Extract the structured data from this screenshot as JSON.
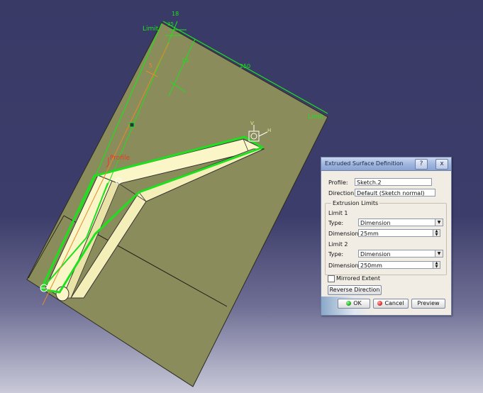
{
  "viewport": {
    "labels": {
      "limit_top": "Limit",
      "limit_right": "Limit",
      "profile": "Profile",
      "dim_18": "18",
      "dim_35": "35",
      "dim_250": "250",
      "dim_15": "15",
      "dim_5": "5",
      "axis_v": "V",
      "axis_h": "H"
    },
    "colors": {
      "background": "#3d3d6b",
      "plane": "#8b8c5c",
      "surface": "#fbf6c8",
      "highlight": "#1ee01e",
      "dimension": "#e58a2a",
      "profile_label": "#e83a20"
    }
  },
  "dialog": {
    "title": "Extruded Surface Definition",
    "help_icon": "?",
    "close_icon": "x",
    "profile_label": "Profile:",
    "profile_value": "Sketch.2",
    "direction_label": "Direction:",
    "direction_value": "Default (Sketch normal)",
    "extrusion_limits_label": "Extrusion Limits",
    "limit1": {
      "heading": "Limit 1",
      "type_label": "Type:",
      "type_value": "Dimension",
      "dimension_label": "Dimension:",
      "dimension_value": "25mm"
    },
    "limit2": {
      "heading": "Limit 2",
      "type_label": "Type:",
      "type_value": "Dimension",
      "dimension_label": "Dimension:",
      "dimension_value": "250mm"
    },
    "mirrored_label": "Mirrored Extent",
    "mirrored_checked": false,
    "reverse_label": "Reverse Direction",
    "ok_label": "OK",
    "cancel_label": "Cancel",
    "preview_label": "Preview"
  }
}
